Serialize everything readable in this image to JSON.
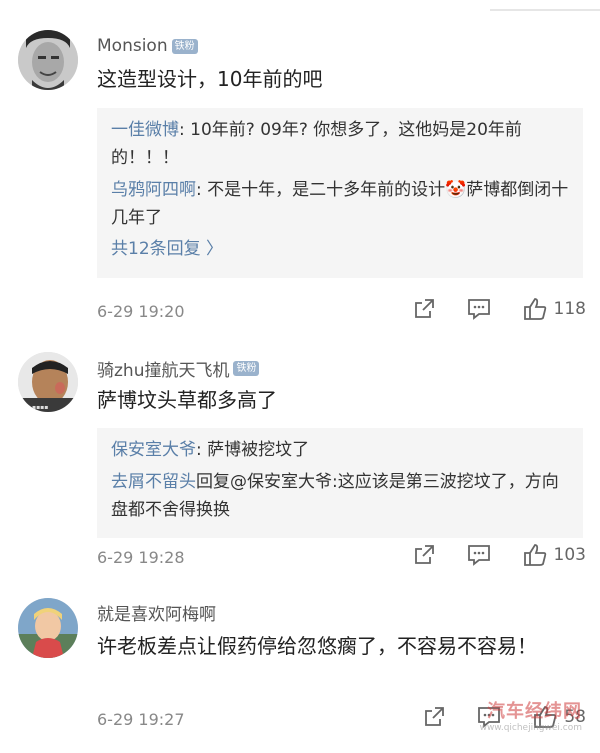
{
  "comments": [
    {
      "username": "Monsion",
      "badge": "铁粉",
      "text": "这造型设计，10年前的吧",
      "replies": [
        {
          "user": "一佳微博",
          "text": ": 10年前? 09年? 你想多了，这他妈是20年前的！！！"
        },
        {
          "user": "乌鸦阿四啊",
          "text": ": 不是十年，是二十多年前的设计🤡萨博都倒闭十几年了"
        }
      ],
      "more_replies": "共12条回复 〉",
      "timestamp": "6-29 19:20",
      "likes": "118"
    },
    {
      "username": "骑zhu撞航天飞机",
      "badge": "铁粉",
      "text": "萨博坟头草都多高了",
      "replies": [
        {
          "user": "保安室大爷",
          "text": ": 萨博被挖坟了"
        },
        {
          "user": "去屑不留头",
          "text": "回复@保安室大爷:这应该是第三波挖坟了，方向盘都不舍得换换"
        }
      ],
      "timestamp": "6-29 19:28",
      "likes": "103"
    },
    {
      "username": "就是喜欢阿梅啊",
      "text": "许老板差点让假药停给忽悠瘸了，不容易不容易！",
      "timestamp": "6-29 19:27",
      "likes": "58"
    }
  ],
  "icons": {
    "share": "share-icon",
    "comment": "comment-icon",
    "like": "thumbs-up-icon"
  },
  "colors": {
    "username": "#555555",
    "reply_user": "#5a7fa8",
    "reply_bg": "#f5f5f5",
    "badge_bg": "#9ab2cc",
    "timestamp": "#888888"
  },
  "watermark": {
    "main": "汽车经纬网",
    "sub": "www.qichejingwei.com"
  }
}
